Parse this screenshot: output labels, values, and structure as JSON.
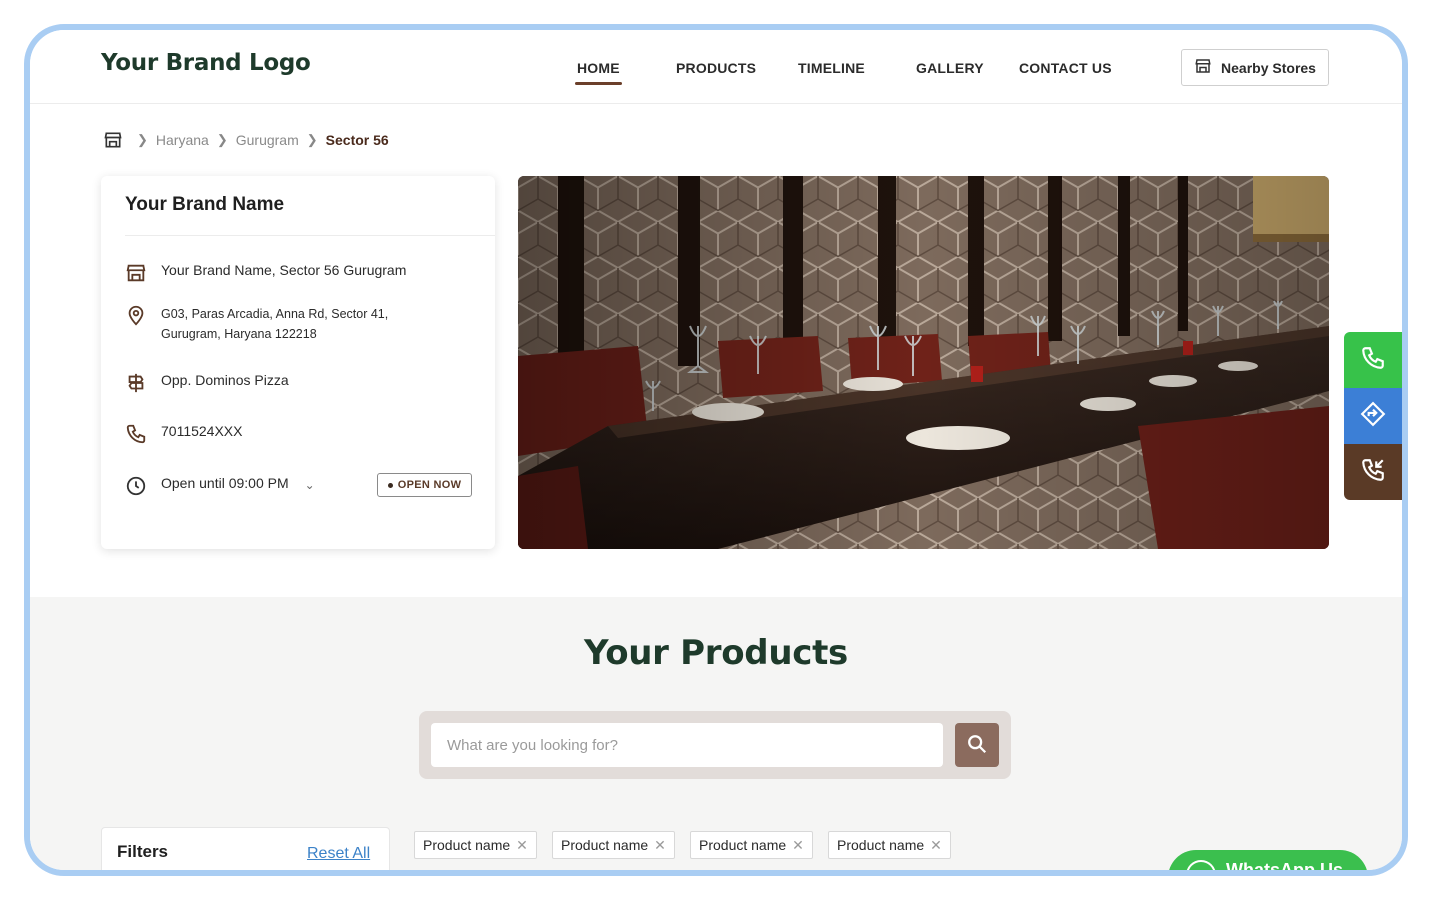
{
  "header": {
    "logo": "Your Brand Logo",
    "nav": [
      {
        "label": "HOME",
        "active": true
      },
      {
        "label": "PRODUCTS",
        "active": false
      },
      {
        "label": "TIMELINE",
        "active": false
      },
      {
        "label": "GALLERY",
        "active": false
      },
      {
        "label": "CONTACT US",
        "active": false
      }
    ],
    "nearby_button": {
      "label": "Nearby Stores",
      "icon": "store-icon"
    }
  },
  "breadcrumb": {
    "icon": "store-icon",
    "items": [
      "Haryana",
      "Gurugram",
      "Sector 56"
    ]
  },
  "store_card": {
    "title": "Your Brand Name",
    "name_line": "Your Brand Name, Sector 56 Gurugram",
    "address_line1": "G03, Paras Arcadia, Anna Rd, Sector 41,",
    "address_line2": "Gurugram, Haryana 122218",
    "landmark": "Opp. Dominos Pizza",
    "phone": "7011524XXX",
    "hours": "Open until 09:00 PM",
    "status_badge": "OPEN NOW"
  },
  "side_actions": [
    {
      "name": "call",
      "icon": "phone-icon",
      "color": "#37c24a"
    },
    {
      "name": "directions",
      "icon": "directions-icon",
      "color": "#3c7fd6"
    },
    {
      "name": "callback",
      "icon": "phone-callback-icon",
      "color": "#5a3a26"
    }
  ],
  "products": {
    "title": "Your Products",
    "search_placeholder": "What are you looking for?",
    "filters_title": "Filters",
    "reset_label": "Reset All",
    "chips": [
      "Product name",
      "Product name",
      "Product name",
      "Product name"
    ]
  },
  "whatsapp": {
    "label": "WhatsApp Us",
    "color": "#3bbf4e"
  },
  "colors": {
    "brand_dark": "#1e3a2b",
    "accent_brown": "#6b3f2a",
    "frame_border": "#a9cdf3"
  }
}
